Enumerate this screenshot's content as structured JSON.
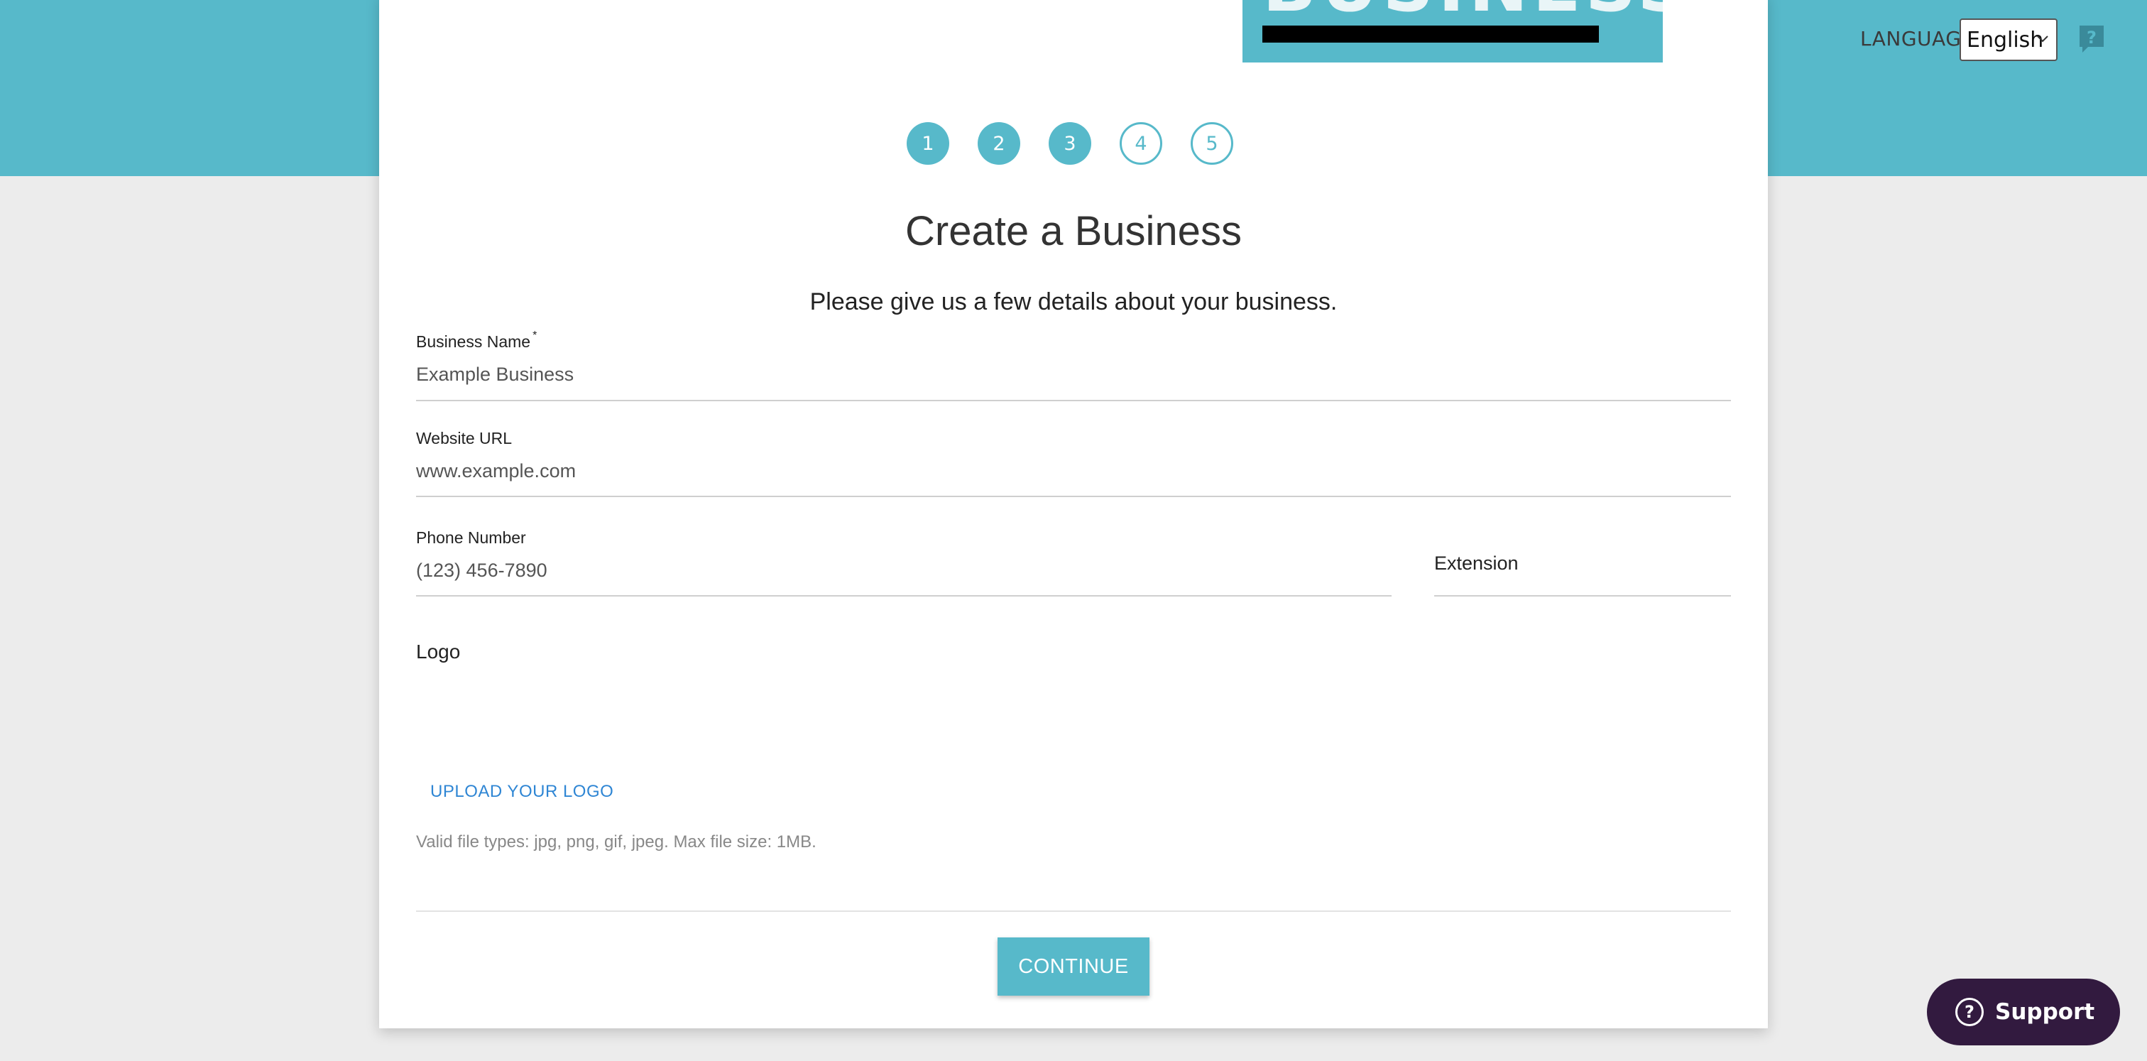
{
  "header": {
    "language_label": "LANGUAGE",
    "language_selected": "English",
    "help_icon": "question-bubble-icon",
    "brand_color": "#57b9ca"
  },
  "steps": [
    {
      "label": "1",
      "state": "done"
    },
    {
      "label": "2",
      "state": "done"
    },
    {
      "label": "3",
      "state": "done"
    },
    {
      "label": "4",
      "state": "todo"
    },
    {
      "label": "5",
      "state": "todo"
    }
  ],
  "form": {
    "title": "Create a Business",
    "subtitle": "Please give us a few details about your business.",
    "business_name": {
      "label": "Business Name",
      "required_mark": "*",
      "placeholder": "Example Business"
    },
    "website": {
      "label": "Website URL",
      "placeholder": "www.example.com"
    },
    "phone": {
      "label": "Phone Number",
      "placeholder": "(123) 456-7890"
    },
    "extension": {
      "label": "Extension"
    },
    "logo": {
      "label": "Logo",
      "upload_label": "UPLOAD YOUR LOGO",
      "hint": "Valid file types: jpg, png, gif, jpeg. Max file size: 1MB."
    },
    "continue_label": "CONTINUE"
  },
  "support": {
    "label": "Support",
    "icon": "question-circle-icon"
  }
}
